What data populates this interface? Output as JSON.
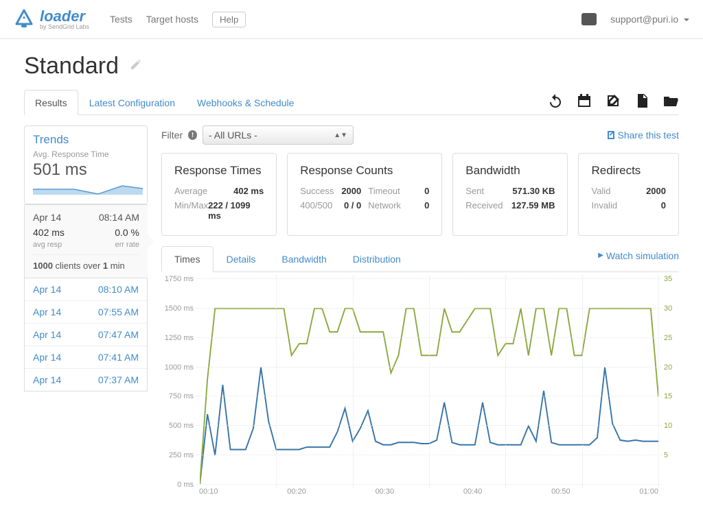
{
  "header": {
    "brand_name": "loader",
    "brand_sub": "by SendGrid Labs",
    "nav": {
      "tests": "Tests",
      "target_hosts": "Target hosts",
      "help": "Help"
    },
    "user_email": "support@puri.io"
  },
  "page": {
    "title": "Standard",
    "tabs": {
      "results": "Results",
      "config": "Latest Configuration",
      "webhooks": "Webhooks & Schedule"
    }
  },
  "sidebar": {
    "trends_title": "Trends",
    "trends_sub": "Avg. Response Time",
    "trends_value": "501 ms",
    "current": {
      "date": "Apr 14",
      "time": "08:14 AM",
      "resp": "402 ms",
      "resp_label": "avg resp",
      "err": "0.0 %",
      "err_label": "err rate",
      "clients_prefix": "1000",
      "clients_mid": " clients over ",
      "clients_suffix": "1",
      "clients_end": " min"
    },
    "history": [
      {
        "date": "Apr 14",
        "time": "08:10 AM"
      },
      {
        "date": "Apr 14",
        "time": "07:55 AM"
      },
      {
        "date": "Apr 14",
        "time": "07:47 AM"
      },
      {
        "date": "Apr 14",
        "time": "07:41 AM"
      },
      {
        "date": "Apr 14",
        "time": "07:37 AM"
      }
    ]
  },
  "filter": {
    "label": "Filter",
    "selected": "- All URLs -",
    "share": "Share this test"
  },
  "cards": {
    "response_times": {
      "title": "Response Times",
      "rows": [
        {
          "k": "Average",
          "v": "402 ms"
        },
        {
          "k": "Min/Max",
          "v": "222 / 1099 ms"
        }
      ]
    },
    "response_counts": {
      "title": "Response Counts",
      "left": [
        {
          "k": "Success",
          "v": "2000"
        },
        {
          "k": "400/500",
          "v": "0 / 0"
        }
      ],
      "right": [
        {
          "k": "Timeout",
          "v": "0"
        },
        {
          "k": "Network",
          "v": "0"
        }
      ]
    },
    "bandwidth": {
      "title": "Bandwidth",
      "rows": [
        {
          "k": "Sent",
          "v": "571.30 KB"
        },
        {
          "k": "Received",
          "v": "127.59 MB"
        }
      ]
    },
    "redirects": {
      "title": "Redirects",
      "rows": [
        {
          "k": "Valid",
          "v": "2000"
        },
        {
          "k": "Invalid",
          "v": "0"
        }
      ]
    }
  },
  "sub_tabs": {
    "times": "Times",
    "details": "Details",
    "bandwidth": "Bandwidth",
    "distribution": "Distribution",
    "watch": "Watch simulation"
  },
  "chart_data": {
    "type": "line",
    "xlabel": "",
    "ylabel_left": "ms",
    "ylabel_right": "",
    "y_left_ticks": [
      0,
      250,
      500,
      750,
      1000,
      1250,
      1500,
      1750
    ],
    "y_left_tick_labels": [
      "0 ms",
      "250 ms",
      "500 ms",
      "750 ms",
      "1000 ms",
      "1250 ms",
      "1500 ms",
      "1750 ms"
    ],
    "y_right_ticks": [
      5,
      10,
      15,
      20,
      25,
      30,
      35
    ],
    "x_ticks": [
      10,
      20,
      30,
      40,
      50,
      60
    ],
    "x_tick_labels": [
      "00:10",
      "00:20",
      "00:30",
      "00:40",
      "00:50",
      "01:00"
    ],
    "x_range": [
      0,
      60
    ],
    "y_left_range": [
      0,
      1750
    ],
    "y_right_range": [
      0,
      35
    ],
    "series": [
      {
        "name": "response_ms",
        "axis": "left",
        "color": "#3774a8",
        "x": [
          0,
          1,
          2,
          3,
          4,
          5,
          6,
          7,
          8,
          9,
          10,
          11,
          12,
          13,
          14,
          15,
          16,
          17,
          18,
          19,
          20,
          21,
          22,
          23,
          24,
          25,
          26,
          27,
          28,
          29,
          30,
          31,
          32,
          33,
          34,
          35,
          36,
          37,
          38,
          39,
          40,
          41,
          42,
          43,
          44,
          45,
          46,
          47,
          48,
          49,
          50,
          51,
          52,
          53,
          54,
          55,
          56,
          57,
          58,
          59,
          60
        ],
        "values": [
          0,
          600,
          250,
          850,
          300,
          300,
          300,
          480,
          1000,
          540,
          300,
          300,
          300,
          300,
          320,
          320,
          320,
          320,
          450,
          650,
          370,
          480,
          630,
          370,
          340,
          340,
          360,
          360,
          360,
          350,
          350,
          380,
          700,
          360,
          340,
          340,
          340,
          700,
          360,
          340,
          340,
          340,
          340,
          500,
          370,
          800,
          360,
          340,
          340,
          340,
          340,
          340,
          400,
          1000,
          520,
          380,
          370,
          380,
          370,
          370,
          370
        ]
      },
      {
        "name": "clients",
        "axis": "right",
        "color": "#8ca93e",
        "x": [
          0,
          1,
          2,
          3,
          4,
          5,
          6,
          7,
          8,
          9,
          10,
          11,
          12,
          13,
          14,
          15,
          16,
          17,
          18,
          19,
          20,
          21,
          22,
          23,
          24,
          25,
          26,
          27,
          28,
          29,
          30,
          31,
          32,
          33,
          34,
          35,
          36,
          37,
          38,
          39,
          40,
          41,
          42,
          43,
          44,
          45,
          46,
          47,
          48,
          49,
          50,
          51,
          52,
          53,
          54,
          55,
          56,
          57,
          58,
          59,
          60
        ],
        "values": [
          0,
          18,
          30,
          30,
          30,
          30,
          30,
          30,
          30,
          30,
          30,
          30,
          22,
          24,
          24,
          30,
          30,
          26,
          26,
          30,
          30,
          26,
          26,
          26,
          26,
          19,
          22,
          30,
          30,
          22,
          22,
          22,
          30,
          26,
          26,
          28,
          30,
          30,
          30,
          22,
          24,
          24,
          30,
          22,
          30,
          30,
          22,
          30,
          30,
          22,
          22,
          30,
          30,
          30,
          30,
          30,
          30,
          30,
          30,
          30,
          15
        ]
      }
    ]
  }
}
